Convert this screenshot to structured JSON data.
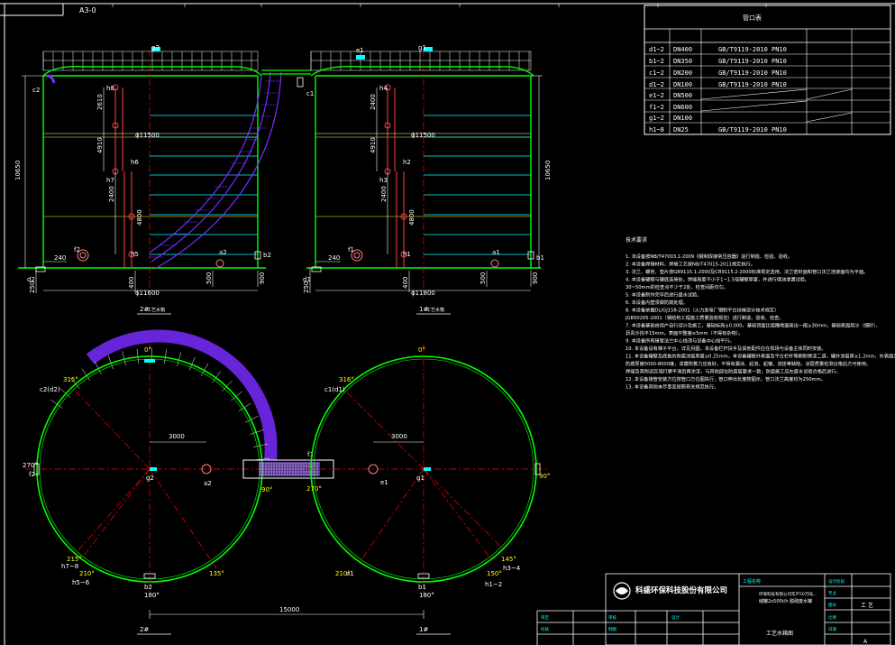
{
  "title_tag": "A3-0",
  "colors": {
    "background": "#000000",
    "tank_wall": "#00ff00",
    "pipe_and_dims": "#ffffff",
    "centerline": "#ff0000",
    "stair": "#7a2aff",
    "nozzle": "#ff8080",
    "water_level": "#00ffff",
    "yellow_text": "#ffff00",
    "title_block_text": "#00ffff"
  },
  "nozzle_table": {
    "title": "管口表",
    "rows": [
      {
        "tag": "d1~2",
        "dn": "DN400",
        "std": "GB/T9119-2010 PN10"
      },
      {
        "tag": "b1~2",
        "dn": "DN350",
        "std": "GB/T9119-2010 PN10"
      },
      {
        "tag": "c1~2",
        "dn": "DN200",
        "std": "GB/T9119-2010 PN10"
      },
      {
        "tag": "d1~2",
        "dn": "DN100",
        "std": "GB/T9119-2010 PN10"
      },
      {
        "tag": "e1~2",
        "dn": "DN500",
        "std": ""
      },
      {
        "tag": "f1~2",
        "dn": "DN600",
        "std": ""
      },
      {
        "tag": "g1~2",
        "dn": "DN100",
        "std": ""
      },
      {
        "tag": "h1~8",
        "dn": "DN25",
        "std": "GB/T9119-2010 PN10"
      }
    ]
  },
  "elevation_left": {
    "label": "2#",
    "nozzles": {
      "g": "g2",
      "c": "c2",
      "h8": "h8",
      "h6": "h6",
      "h7": "h7",
      "h5": "h5",
      "f": "f2",
      "a": "a2",
      "b": "b2",
      "d": "d2"
    },
    "dims": {
      "d_top": "ϕ11500",
      "d_bottom": "ϕ11600",
      "height": "10650",
      "h_2610": "2610",
      "h_4910": "4910",
      "h_2400": "2400",
      "h_4800": "4800",
      "base_250": "250",
      "left_240": "240",
      "n_400": "400",
      "n_500": "500",
      "n_900": "900"
    }
  },
  "elevation_right": {
    "label": "1#",
    "nozzles": {
      "e": "e1",
      "g": "g1",
      "c": "c1",
      "h4": "h4",
      "h2": "h2",
      "h3": "h3",
      "h1": "h1",
      "f": "f1",
      "a": "a1",
      "b": "b1",
      "d": "d1"
    },
    "dims": {
      "d_top": "ϕ11500",
      "d_bottom": "ϕ11800",
      "height": "10650",
      "h_2400a": "2400",
      "h_4910": "4910",
      "h_2400b": "2400",
      "h_4800": "4800",
      "base_250": "250",
      "left_240": "240",
      "n_400": "400",
      "n_500": "500",
      "n_900": "900"
    }
  },
  "plan_left": {
    "label": "2#",
    "angles": {
      "a0": "0°",
      "a90": "90°",
      "a180": "180°",
      "a270": "270°",
      "a315": "315°",
      "a215": "215°",
      "a210": "210°",
      "a135": "135°"
    },
    "nozzles": {
      "c": "c2(d2)",
      "f": "f2",
      "g": "g2",
      "a": "a2",
      "b": "b2",
      "h7": "h7~8",
      "h5": "h5~6"
    },
    "dims": {
      "offset": "3000"
    }
  },
  "plan_right": {
    "label": "1#",
    "angles": {
      "a0": "0°",
      "a90": "90°",
      "a180": "180°",
      "a270": "270°",
      "a316": "316°",
      "a210": "210°",
      "a150": "150°",
      "a145": "145°"
    },
    "nozzles": {
      "c": "c1(d1)",
      "f": "f1",
      "g": "g1",
      "e": "e1",
      "a": "a1",
      "b": "b1",
      "h3": "h3~4",
      "h1": "h1~2"
    },
    "dims": {
      "offset": "3000"
    }
  },
  "plan_spacing": "15000",
  "notes": {
    "heading": "技术要求",
    "lines": [
      "1. 本设备按NB/T47003.1-2009《钢制焊接常压容器》进行制造、检验、验收。",
      "2. 本设备焊接材料、焊接工艺按NB/T47015-2011规定执行。",
      "3. 法兰、螺栓、垫片按GB9115.1-2000及CB9115.2-2000标准规定选用，法兰密封面和管口法兰连接面均为平面。",
      "4. 本设备罐壁与罐底连接处，焊缝高度不小于1~1.5倍罐壁厚度，并进行煤油渗漏试验。",
      "   30~50mm的检查点不少于2处，检查间距均匀。",
      "5. 本设备制作完毕后进行盛水试验。",
      "6. 本设备内壁须做防腐处理。",
      "8. 本设备依据DL/GJ158-2001（火力发电厂钢制平台扶梯设计技术规定）",
      "   JGB50205-2001（钢结构工程施工质量验收规范）进行制造、验收、检查。",
      "7. 本设备基础由用户自行设计及施工，基础标高±0.000，基础顶面比周围地面高出一般≥30mm，基础表面用沙（细砂）、",
      "   沥青沙找平15mm，表面平整度≤5mm（不得有杂物）。",
      "9. 本设备所有接管法兰中心线须与设备中心线平行。",
      "10. 本设备设有梯子平台，详见另图，本设备栏杆扶手及其他配件应在现场与设备主体同时安装。",
      "11. 本设备罐壁及底板的防腐涂层厚度≥0.25mm，本设备罐壁外表面及平台栏杆等刷防锈漆二道，罐外涂层厚≥1.2mm，外表面涂层颜色按业主要求。",
      "    防腐厚度5000-8000度，漆膜附着力应良好，不得有漏涂、起泡、起皱、流挂等缺陷，涂层质量检测合格后方可使用。",
      "    焊缝及其附近区域打磨平滑后再涂漆，与其他部位防腐层要求一致，防腐施工应在盛水试验合格后进行。",
      "12. 本设备接管安装方位按管口方位图执行，管口伸出长度按图示，管口法兰高度均为250mm。",
      "13. 本设备其他未尽事宜按照有关规范执行。"
    ]
  },
  "title_block": {
    "company": "科盛环保科技股份有限公司",
    "project_label": "工程名称",
    "drawing_title": "环保科技有限公司年产50万吨...",
    "drawing_subtitle": "储罐2x500t/h 脱硫废水罐",
    "drawing_name": "工艺水箱图",
    "discipline": "工  艺",
    "row_labels": [
      "审定",
      "审核",
      "设计",
      "校核",
      "制图"
    ],
    "right_labels": [
      "设计阶段",
      "专业",
      "图号",
      "比例",
      "日期"
    ],
    "sheet": "A"
  }
}
